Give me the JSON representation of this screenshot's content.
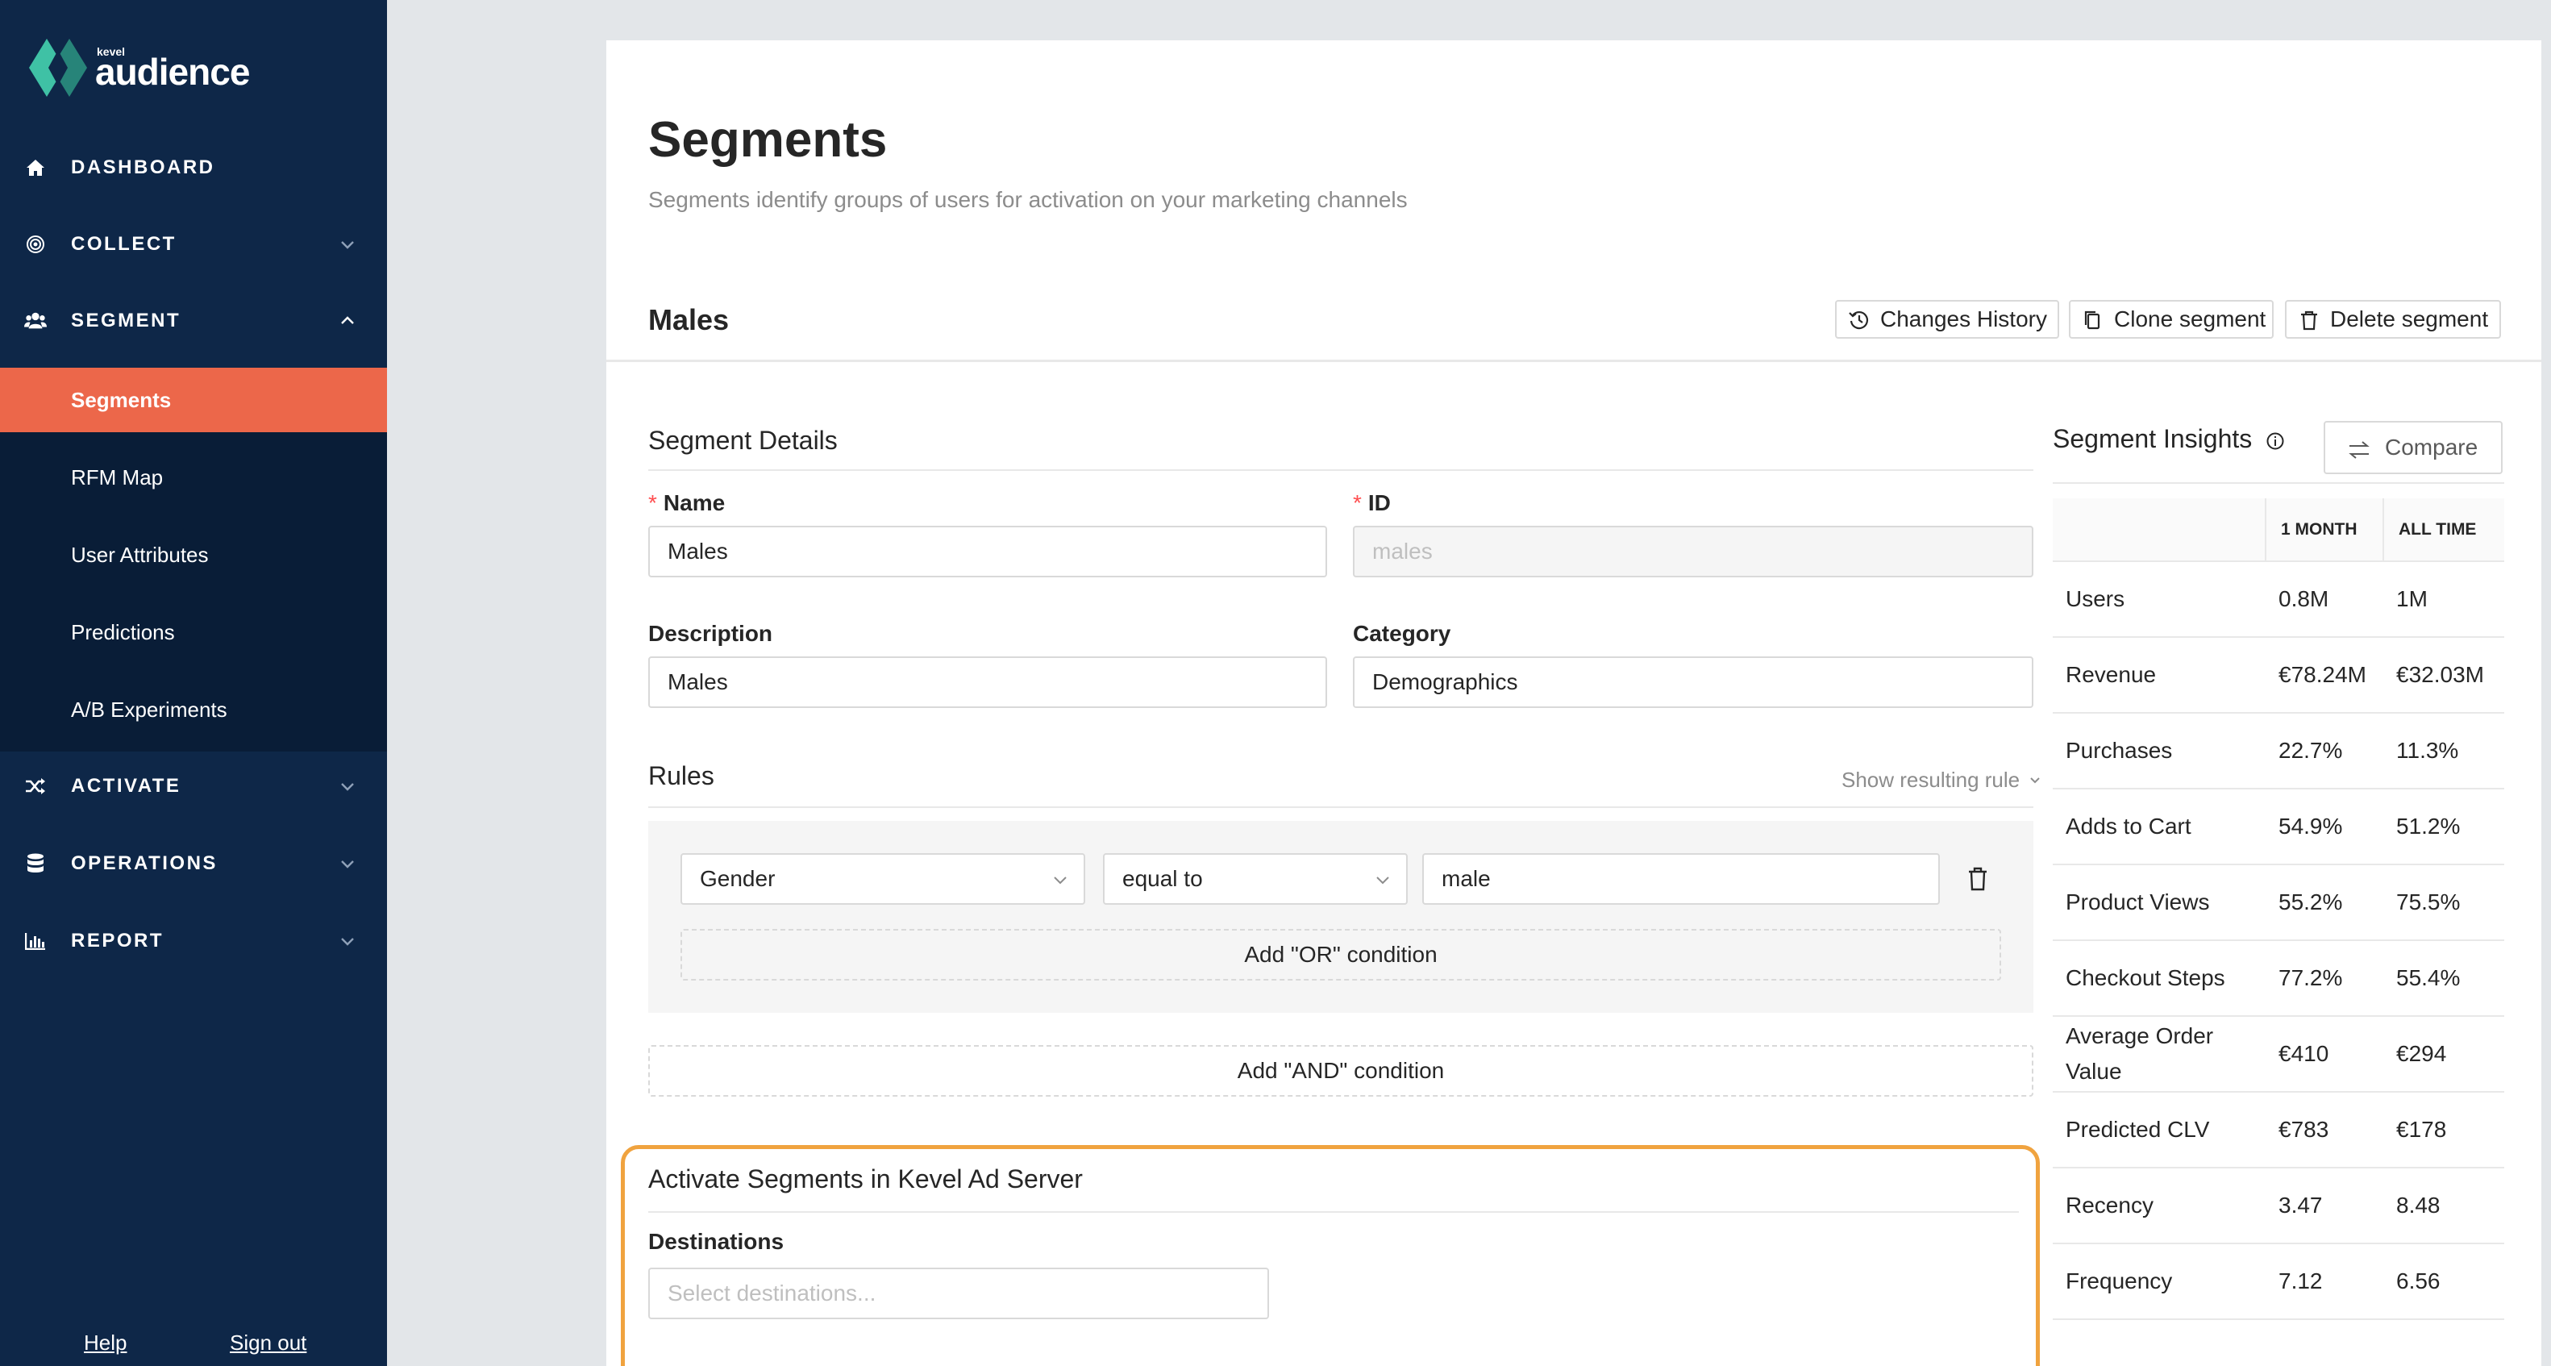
{
  "brand": {
    "small": "kevel",
    "name": "audience"
  },
  "nav": {
    "dashboard": "DASHBOARD",
    "collect": "COLLECT",
    "segment": "SEGMENT",
    "activate": "ACTIVATE",
    "operations": "OPERATIONS",
    "report": "REPORT"
  },
  "subnav": [
    "Segments",
    "RFM Map",
    "User Attributes",
    "Predictions",
    "A/B Experiments"
  ],
  "footer": {
    "help": "Help",
    "signout": "Sign out"
  },
  "page": {
    "title": "Segments",
    "subtitle": "Segments identify groups of users for activation on your marketing channels"
  },
  "segment": {
    "name": "Males",
    "actions": {
      "history": "Changes History",
      "clone": "Clone segment",
      "delete": "Delete segment"
    }
  },
  "details": {
    "title": "Segment Details",
    "name_label": "Name",
    "name_value": "Males",
    "id_label": "ID",
    "id_value": "males",
    "description_label": "Description",
    "description_value": "Males",
    "category_label": "Category",
    "category_value": "Demographics"
  },
  "rules": {
    "title": "Rules",
    "show_rule": "Show resulting rule",
    "attribute": "Gender",
    "operator": "equal to",
    "value": "male",
    "add_or": "Add \"OR\" condition",
    "add_and": "Add \"AND\" condition"
  },
  "activate": {
    "title": "Activate Segments in Kevel Ad Server",
    "destinations_label": "Destinations",
    "destinations_placeholder": "Select destinations..."
  },
  "insights": {
    "title": "Segment Insights",
    "compare": "Compare",
    "col_month": "1 MONTH",
    "col_all": "ALL TIME",
    "rows": [
      {
        "label": "Users",
        "month": "0.8M",
        "all": "1M"
      },
      {
        "label": "Revenue",
        "month": "€78.24M",
        "all": "€32.03M"
      },
      {
        "label": "Purchases",
        "month": "22.7%",
        "all": "11.3%"
      },
      {
        "label": "Adds to Cart",
        "month": "54.9%",
        "all": "51.2%"
      },
      {
        "label": "Product Views",
        "month": "55.2%",
        "all": "75.5%"
      },
      {
        "label": "Checkout Steps",
        "month": "77.2%",
        "all": "55.4%"
      },
      {
        "label": "Average Order Value",
        "month": "€410",
        "all": "€294"
      },
      {
        "label": "Predicted CLV",
        "month": "€783",
        "all": "€178"
      },
      {
        "label": "Recency",
        "month": "3.47",
        "all": "8.48"
      },
      {
        "label": "Frequency",
        "month": "7.12",
        "all": "6.56"
      }
    ]
  },
  "colors": {
    "sidebar": "#0e2748",
    "active": "#ec674a",
    "highlight": "#f0a33f",
    "logo": "#3fc1a5"
  }
}
